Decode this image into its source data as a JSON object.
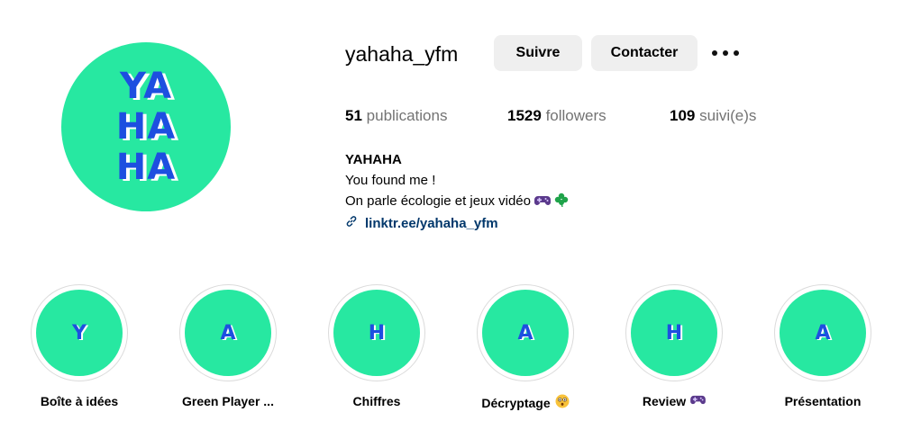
{
  "profile": {
    "avatar_lines": [
      "YA",
      "HA",
      "HA"
    ],
    "username": "yahaha_yfm",
    "buttons": {
      "follow": "Suivre",
      "contact": "Contacter"
    },
    "more_icon": "more-horizontal-icon",
    "stats": {
      "posts_count": "51",
      "posts_label": "publications",
      "followers_count": "1529",
      "followers_label": "followers",
      "following_count": "109",
      "following_label": "suivi(e)s"
    },
    "bio": {
      "name": "YAHAHA",
      "line1": "You found me !",
      "line2": "On parle écologie et jeux vidéo",
      "line2_icons": [
        "gamepad-icon",
        "four-leaf-clover-icon"
      ],
      "link": "linktr.ee/yahaha_yfm",
      "link_icon": "link-icon"
    }
  },
  "highlights": [
    {
      "letter": "Y",
      "label": "Boîte à idées"
    },
    {
      "letter": "A",
      "label": "Green Player ..."
    },
    {
      "letter": "H",
      "label": "Chiffres"
    },
    {
      "letter": "A",
      "label": "Décryptage",
      "icon": "hushed-face-emoji"
    },
    {
      "letter": "H",
      "label": "Review",
      "icon": "gamepad-icon"
    },
    {
      "letter": "A",
      "label": "Présentation"
    }
  ],
  "colors": {
    "accent_green": "#27e8a1",
    "logo_blue": "#1d4fe0",
    "link_blue": "#00376b"
  }
}
